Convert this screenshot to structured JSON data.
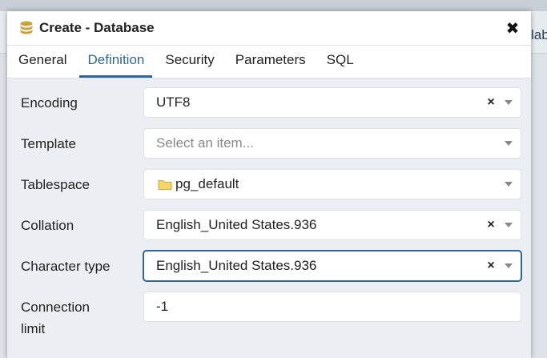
{
  "background": {
    "peek_text": "lab"
  },
  "dialog": {
    "title": "Create - Database",
    "close_icon": "close-icon",
    "db_icon": "database-icon"
  },
  "tabs": [
    {
      "label": "General",
      "active": false
    },
    {
      "label": "Definition",
      "active": true
    },
    {
      "label": "Security",
      "active": false
    },
    {
      "label": "Parameters",
      "active": false
    },
    {
      "label": "SQL",
      "active": false
    }
  ],
  "form": {
    "encoding": {
      "label": "Encoding",
      "value": "UTF8"
    },
    "template": {
      "label": "Template",
      "placeholder": "Select an item..."
    },
    "tablespace": {
      "label": "Tablespace",
      "value": "pg_default",
      "icon": "folder-icon"
    },
    "collation": {
      "label": "Collation",
      "value": "English_United States.936"
    },
    "character_type": {
      "label": "Character type",
      "value": "English_United States.936"
    },
    "connection_limit": {
      "label_line1": "Connection",
      "label_line2": "limit",
      "value": "-1"
    }
  },
  "colors": {
    "accent": "#326690",
    "body_bg": "#ebeef3",
    "folder": "#f5d66b"
  }
}
